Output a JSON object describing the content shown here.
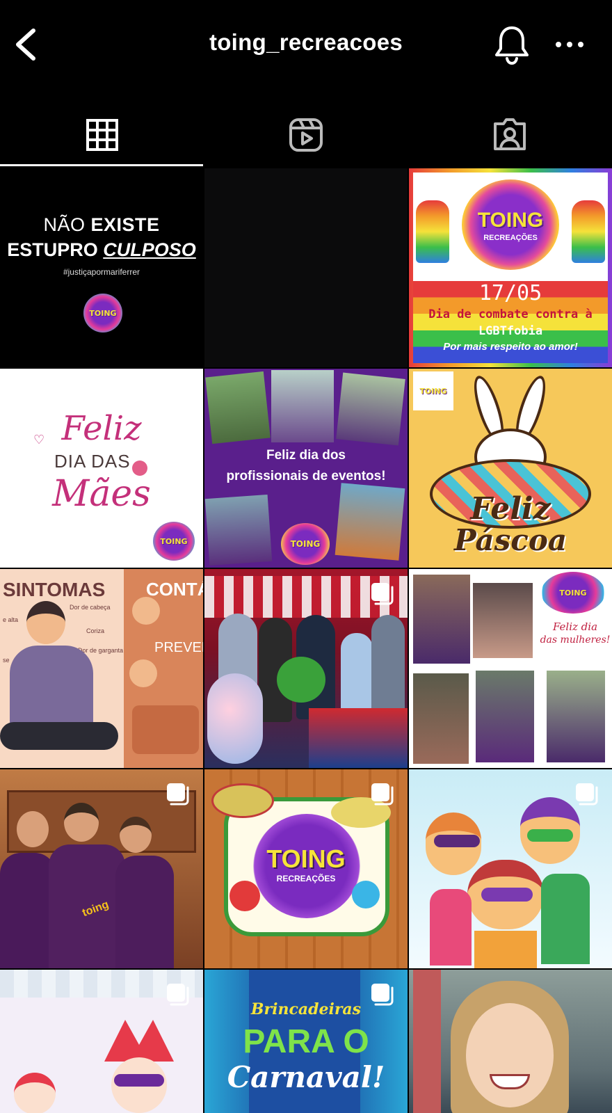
{
  "header": {
    "username": "toing_recreacoes",
    "back_icon": "chevron-left-icon",
    "notifications_icon": "bell-icon",
    "more_icon": "more-horizontal-icon"
  },
  "tabs": [
    {
      "name": "posts",
      "icon": "grid-icon",
      "active": true
    },
    {
      "name": "reels",
      "icon": "reels-icon",
      "active": false
    },
    {
      "name": "tagged",
      "icon": "tagged-person-icon",
      "active": false
    }
  ],
  "posts": {
    "p1": {
      "line1a": "NÃO ",
      "line1b": "EXISTE",
      "line2a": "ESTUPRO ",
      "line2b": "CULPOSO",
      "hashtag": "#justiçapormariferrer",
      "logo": "TOING"
    },
    "p3": {
      "logo": "TOING",
      "logo_sub": "RECREAÇÕES",
      "date": "17/05",
      "line1": "Dia de combate contra à",
      "line2": "LGBTfobia",
      "line3": "Por mais respeito ao amor!"
    },
    "p4": {
      "line1": "Feliz",
      "line2": "DIA DAS",
      "line3": "Mães",
      "logo": "TOING"
    },
    "p5": {
      "line1": "Feliz dia dos",
      "line2": "profissionais de eventos!",
      "logo": "TOING"
    },
    "p6": {
      "line1": "Feliz",
      "line2": "Páscoa",
      "logo": "TOING"
    },
    "p7": {
      "title1": "SINTOMAS",
      "title2": "CONTÁ",
      "label1": "Dor de cabeça",
      "label2": "Coriza",
      "label3": "Dor de garganta",
      "label4": "e alta",
      "label5": "se",
      "prev": "PREVEN"
    },
    "p9": {
      "line1": "Feliz dia",
      "line2": "das mulheres!",
      "logo": "TOING"
    },
    "p10": {
      "shirt": "toing"
    },
    "p11": {
      "logo": "TOING",
      "logo_sub": "RECREAÇÕES"
    },
    "p14": {
      "line1": "Brincadeiras",
      "line2": "PARA O",
      "line3": "Carnaval!"
    }
  },
  "colors": {
    "background": "#000000",
    "text": "#ffffff",
    "brand_purple": "#5a1f8c",
    "brand_yellow": "#f6e43a"
  }
}
